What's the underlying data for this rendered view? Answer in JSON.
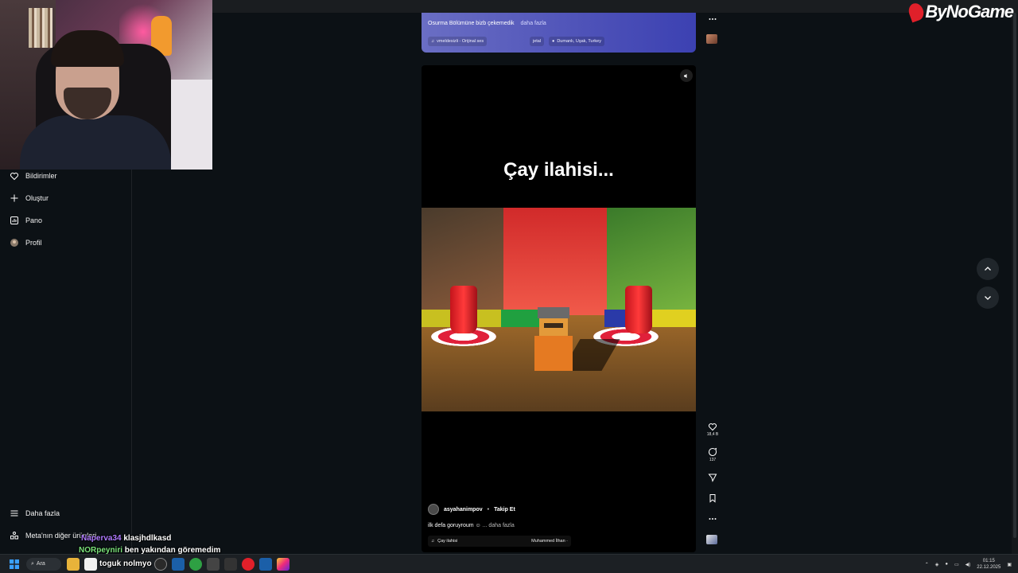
{
  "logo": {
    "text": "ByNoGame"
  },
  "sidebar": {
    "items": [
      {
        "label": "Bildirimler",
        "icon": "heart-icon"
      },
      {
        "label": "Oluştur",
        "icon": "plus-icon"
      },
      {
        "label": "Pano",
        "icon": "dashboard-icon"
      },
      {
        "label": "Profil",
        "icon": "profile-icon"
      }
    ],
    "bottom": [
      {
        "label": "Daha fazla",
        "icon": "menu-icon"
      },
      {
        "label": "Meta'nın diğer ürünleri",
        "icon": "meta-icon"
      }
    ]
  },
  "prev_post": {
    "caption": "Osurma Bölümüne bizb çekemedik",
    "more": "daha fazla",
    "chips": [
      "vmeldesizli - Orijinal ses",
      "jetal",
      "Dumanlı, Uşak, Turkey"
    ]
  },
  "reel": {
    "overlay_title": "Çay ilahisi...",
    "author": "asyahanimpov",
    "follow": "Takip Et",
    "caption": "ilk defa goruyroum",
    "caption_more": "... daha fazla",
    "audio": "Çay ilahisi",
    "audio_artist": "Muhammed İlhan ·",
    "likes": "18,4 B",
    "comments": "137"
  },
  "chat": [
    {
      "user": "Naperva34",
      "msg": "klasjhdlkasd",
      "color": "#b07bff"
    },
    {
      "user": "NORpeyniri",
      "msg": "ben yakından göremedim",
      "color": "#7be37b"
    },
    {
      "user": "toguk",
      "msg": "nolmyo",
      "color": "#ffffff"
    }
  ],
  "taskbar": {
    "search": "Ara",
    "time": "01:15",
    "date": "22.12.2025"
  }
}
